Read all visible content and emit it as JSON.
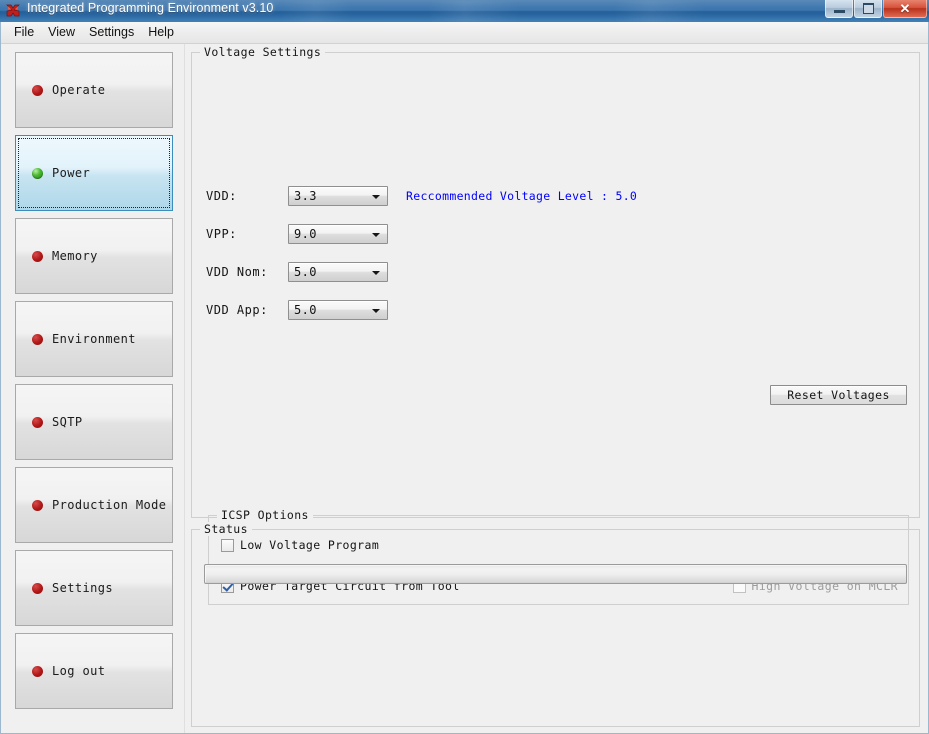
{
  "window": {
    "title": "Integrated Programming Environment v3.10",
    "icon": "butterfly-app-icon",
    "minimize_label": "",
    "maximize_label": "",
    "close_label": "✕"
  },
  "menubar": {
    "items": [
      {
        "label": "File"
      },
      {
        "label": "View"
      },
      {
        "label": "Settings"
      },
      {
        "label": "Help"
      }
    ]
  },
  "sidebar": {
    "items": [
      {
        "label": "Operate",
        "status": "red",
        "selected": false
      },
      {
        "label": "Power",
        "status": "green",
        "selected": true
      },
      {
        "label": "Memory",
        "status": "red",
        "selected": false
      },
      {
        "label": "Environment",
        "status": "red",
        "selected": false
      },
      {
        "label": "SQTP",
        "status": "red",
        "selected": false
      },
      {
        "label": "Production Mode",
        "status": "red",
        "selected": false
      },
      {
        "label": "Settings",
        "status": "red",
        "selected": false
      },
      {
        "label": "Log out",
        "status": "red",
        "selected": false
      }
    ]
  },
  "voltage_settings": {
    "title": "Voltage Settings",
    "rows": [
      {
        "label": "VDD:",
        "value": "3.3"
      },
      {
        "label": "VPP:",
        "value": "9.0"
      },
      {
        "label": "VDD Nom:",
        "value": "5.0"
      },
      {
        "label": "VDD App:",
        "value": "5.0"
      }
    ],
    "recommendation": "Reccommended Voltage Level : 5.0",
    "recommendation_color": "#0000ff",
    "reset_button": "Reset Voltages"
  },
  "icsp_options": {
    "title": "ICSP Options",
    "low_voltage_program": {
      "label": "Low Voltage Program",
      "checked": false,
      "disabled": false
    },
    "power_target_circuit": {
      "label": "Power Target Circuit from Tool",
      "checked": true,
      "disabled": false
    },
    "high_voltage_mclr": {
      "label": "High Voltage on MCLR",
      "checked": false,
      "disabled": true
    }
  },
  "status": {
    "title": "Status",
    "message": ""
  }
}
